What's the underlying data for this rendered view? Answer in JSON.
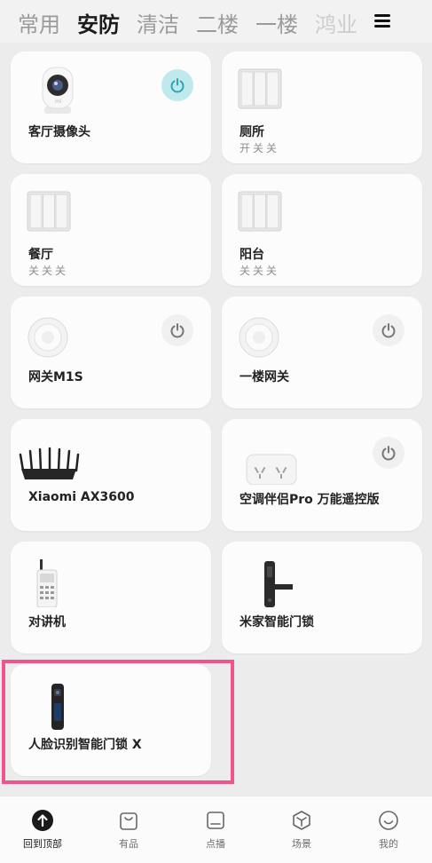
{
  "tabs": [
    "常用",
    "安防",
    "清洁",
    "二楼",
    "一楼",
    "鸿业"
  ],
  "menu_icon": "hamburger-menu-icon",
  "devices": [
    {
      "name": "客厅摄像头",
      "status": "",
      "icon": "camera-icon",
      "power": "on"
    },
    {
      "name": "厕所",
      "status": "开关关",
      "icon": "triple-switch-icon",
      "power": "none"
    },
    {
      "name": "餐厅",
      "status": "关关关",
      "icon": "triple-switch-icon",
      "power": "none"
    },
    {
      "name": "阳台",
      "status": "关关关",
      "icon": "triple-switch-icon",
      "power": "none"
    },
    {
      "name": "网关M1S",
      "status": "",
      "icon": "gateway-icon",
      "power": "off"
    },
    {
      "name": "一楼网关",
      "status": "",
      "icon": "gateway-icon",
      "power": "off"
    },
    {
      "name": "Xiaomi AX3600",
      "status": "",
      "icon": "router-icon",
      "power": "none"
    },
    {
      "name": "空调伴侣Pro 万能遥控版",
      "status": "",
      "icon": "ac-companion-icon",
      "power": "off"
    },
    {
      "name": "对讲机",
      "status": "",
      "icon": "walkie-talkie-icon",
      "power": "none"
    },
    {
      "name": "米家智能门锁",
      "status": "",
      "icon": "door-lock-icon",
      "power": "none"
    },
    {
      "name": "人脸识别智能门锁 X",
      "status": "",
      "icon": "face-door-lock-icon",
      "power": "none"
    }
  ],
  "bottom_nav": [
    {
      "label": "回到顶部",
      "icon": "arrow-up-icon"
    },
    {
      "label": "有品",
      "icon": "shopping-bag-icon"
    },
    {
      "label": "点播",
      "icon": "tv-icon"
    },
    {
      "label": "场景",
      "icon": "cube-icon"
    },
    {
      "label": "我的",
      "icon": "smiley-icon"
    }
  ],
  "colors": {
    "highlight": "#f0548f",
    "power_on": "#bfe9ec",
    "power_on_icon": "#2fa7b3"
  }
}
